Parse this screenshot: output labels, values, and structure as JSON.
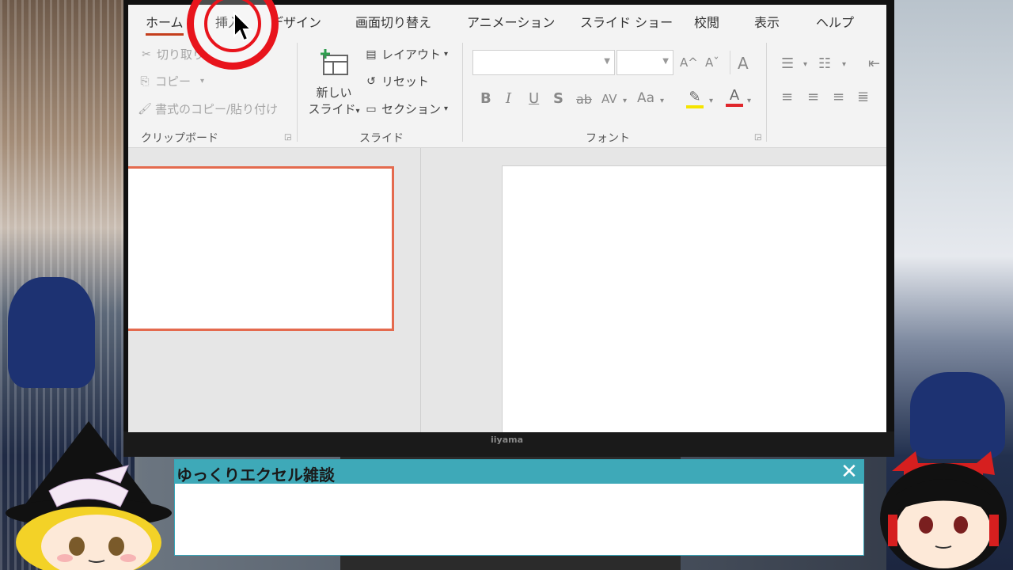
{
  "ribbon_tabs": [
    "ホーム",
    "挿入",
    "デザイン",
    "画面切り替え",
    "アニメーション",
    "スライド ショー",
    "校閲",
    "表示",
    "ヘルプ"
  ],
  "active_tab": "ホーム",
  "clipboard": {
    "cut": "切り取り",
    "copy": "コピー",
    "format_painter": "書式のコピー/貼り付け",
    "group_label": "クリップボード"
  },
  "slides_group": {
    "new_slide_line1": "新しい",
    "new_slide_line2": "スライド",
    "layout": "レイアウト",
    "reset": "リセット",
    "section": "セクション",
    "group_label": "スライド"
  },
  "font_group": {
    "font_name": "",
    "font_size": "",
    "grow": "A^",
    "shrink": "Aˇ",
    "clear": "A",
    "bold": "B",
    "italic": "I",
    "underline": "U",
    "shadow": "S",
    "strike": "ab",
    "spacing": "AV",
    "case": "Aa",
    "group_label": "フォント"
  },
  "monitor_brand": "iiyama",
  "dialog": {
    "title": "ゆっくりエクセル雑談",
    "close": "✕",
    "body": ""
  },
  "colors": {
    "accent": "#c43e1c",
    "dialog_title": "#3ea9b8",
    "highlight_ring": "#e8141c"
  }
}
